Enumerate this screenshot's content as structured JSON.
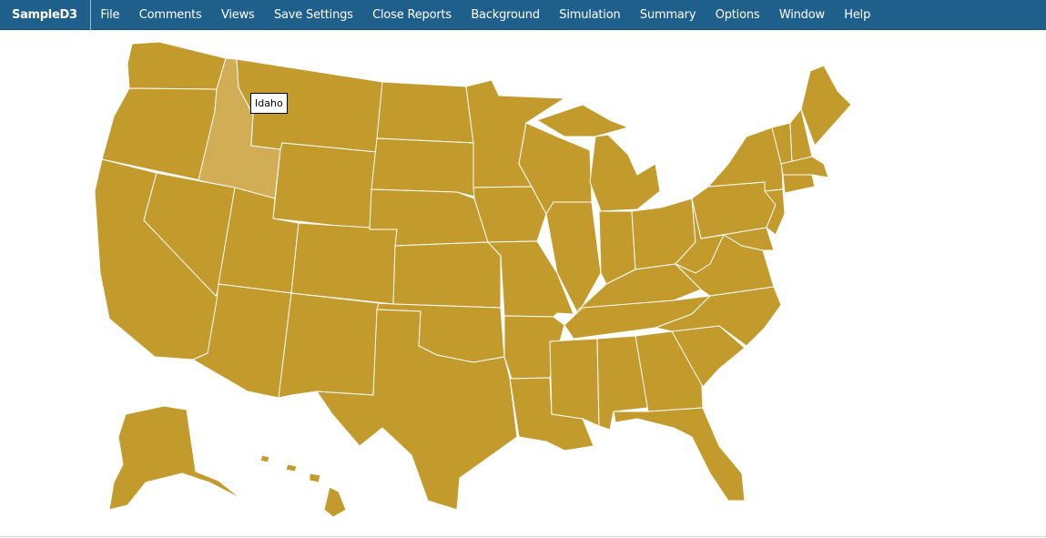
{
  "app": {
    "brand": "SampleD3",
    "menu": [
      "File",
      "Comments",
      "Views",
      "Save Settings",
      "Close Reports",
      "Background",
      "Simulation",
      "Summary",
      "Options",
      "Window",
      "Help"
    ]
  },
  "map": {
    "fill_color": "#c39a2c",
    "highlight_color": "#d1ad56",
    "border_color": "#ffffff",
    "highlighted_state": "Idaho",
    "tooltip": "Idaho"
  }
}
